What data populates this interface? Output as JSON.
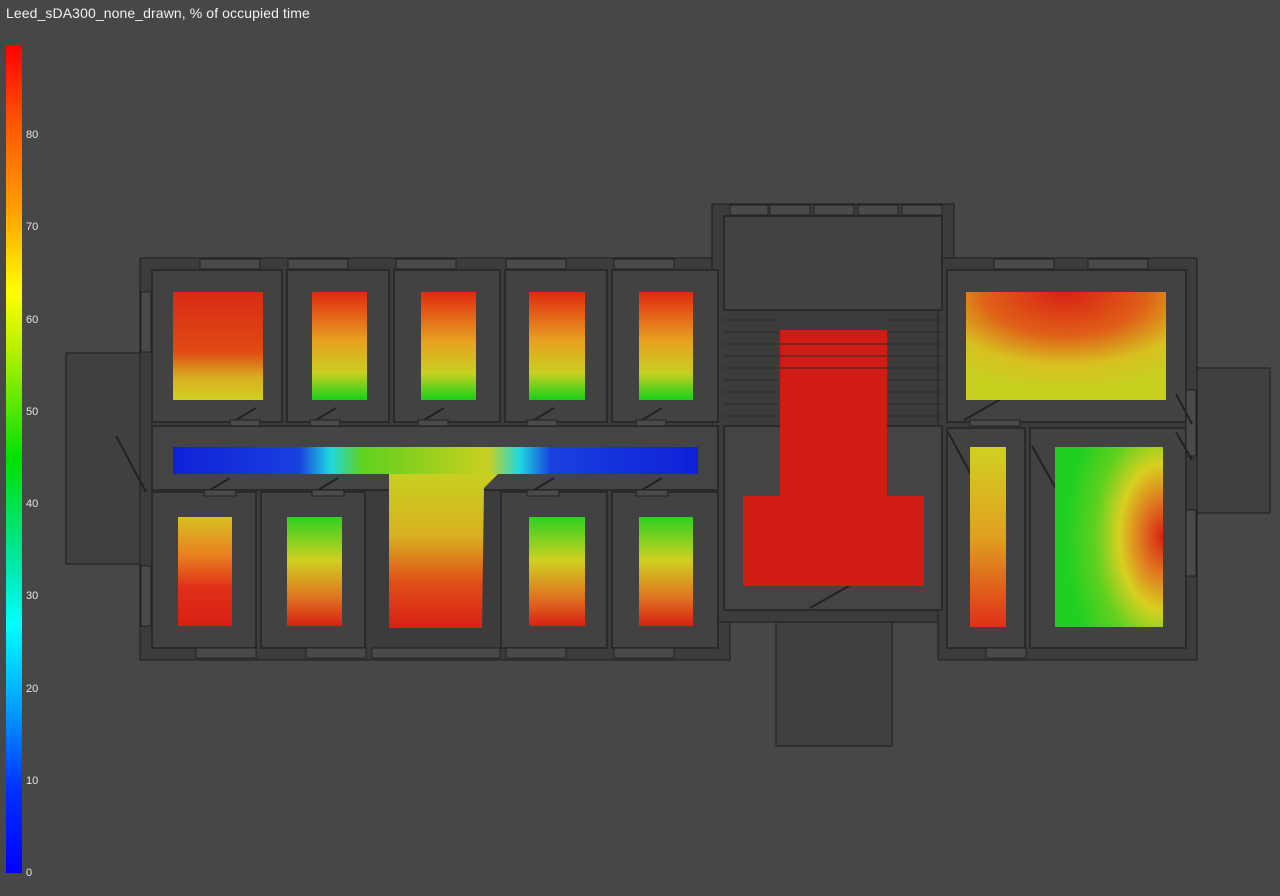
{
  "title": "Leed_sDA300_none_drawn, % of occupied time",
  "legend": {
    "ticks": [
      "80",
      "70",
      "60",
      "50",
      "40",
      "30",
      "20",
      "10",
      "0"
    ],
    "colors": {
      "high": "#ff0000",
      "mid": "#00e000",
      "low": "#0000ff"
    }
  }
}
